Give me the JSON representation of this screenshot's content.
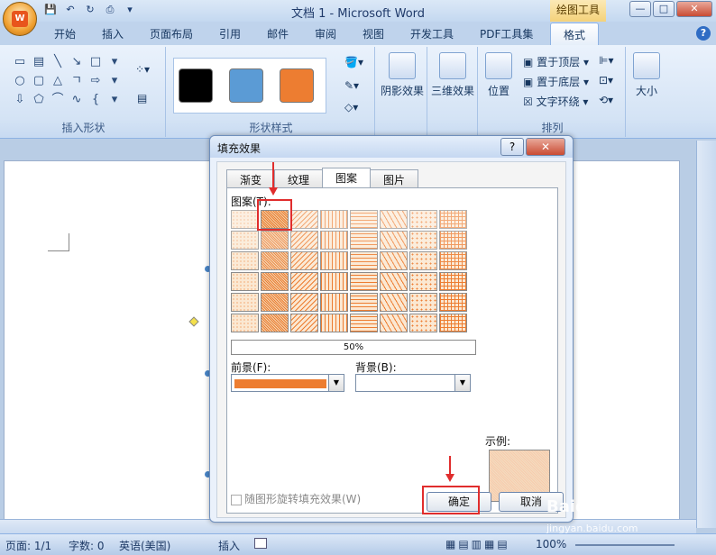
{
  "window": {
    "title": "文档 1 - Microsoft Word",
    "context_tab_header": "绘图工具",
    "min": "—",
    "max": "□",
    "close": "✕"
  },
  "ribbon_tabs": [
    "开始",
    "插入",
    "页面布局",
    "引用",
    "邮件",
    "审阅",
    "视图",
    "开发工具",
    "PDF工具集",
    "格式"
  ],
  "active_tab": "格式",
  "ribbon": {
    "insert_shapes_label": "插入形状",
    "shape_styles_label": "形状样式",
    "arrange_label": "排列",
    "shape_style_colors": [
      "#000000",
      "#5b9bd5",
      "#ed7d31"
    ],
    "shadow_effects": "阴影效果",
    "threed_effects": "三维效果",
    "position": "位置",
    "bring_to_front": "置于顶层",
    "send_to_back": "置于底层",
    "text_wrap": "文字环绕",
    "size": "大小"
  },
  "dialog": {
    "title": "填充效果",
    "help": "?",
    "close": "✕",
    "tabs": [
      "渐变",
      "纹理",
      "图案",
      "图片"
    ],
    "active_tab": "图案",
    "pattern_label": "图案(T):",
    "selected_pattern": "50%",
    "foreground_label": "前景(F):",
    "background_label": "背景(B):",
    "foreground_color": "#ed7d31",
    "background_color": "#ffffff",
    "sample_label": "示例:",
    "rotate_checkbox": "随图形旋转填充效果(W)",
    "ok": "确定",
    "cancel": "取消"
  },
  "status_bar": {
    "page": "页面: 1/1",
    "word_count": "字数: 0",
    "language": "英语(美国)",
    "mode": "插入",
    "zoom": "100%"
  },
  "watermark": {
    "text": "Baidu经验",
    "url": "jingyan.baidu.com"
  }
}
